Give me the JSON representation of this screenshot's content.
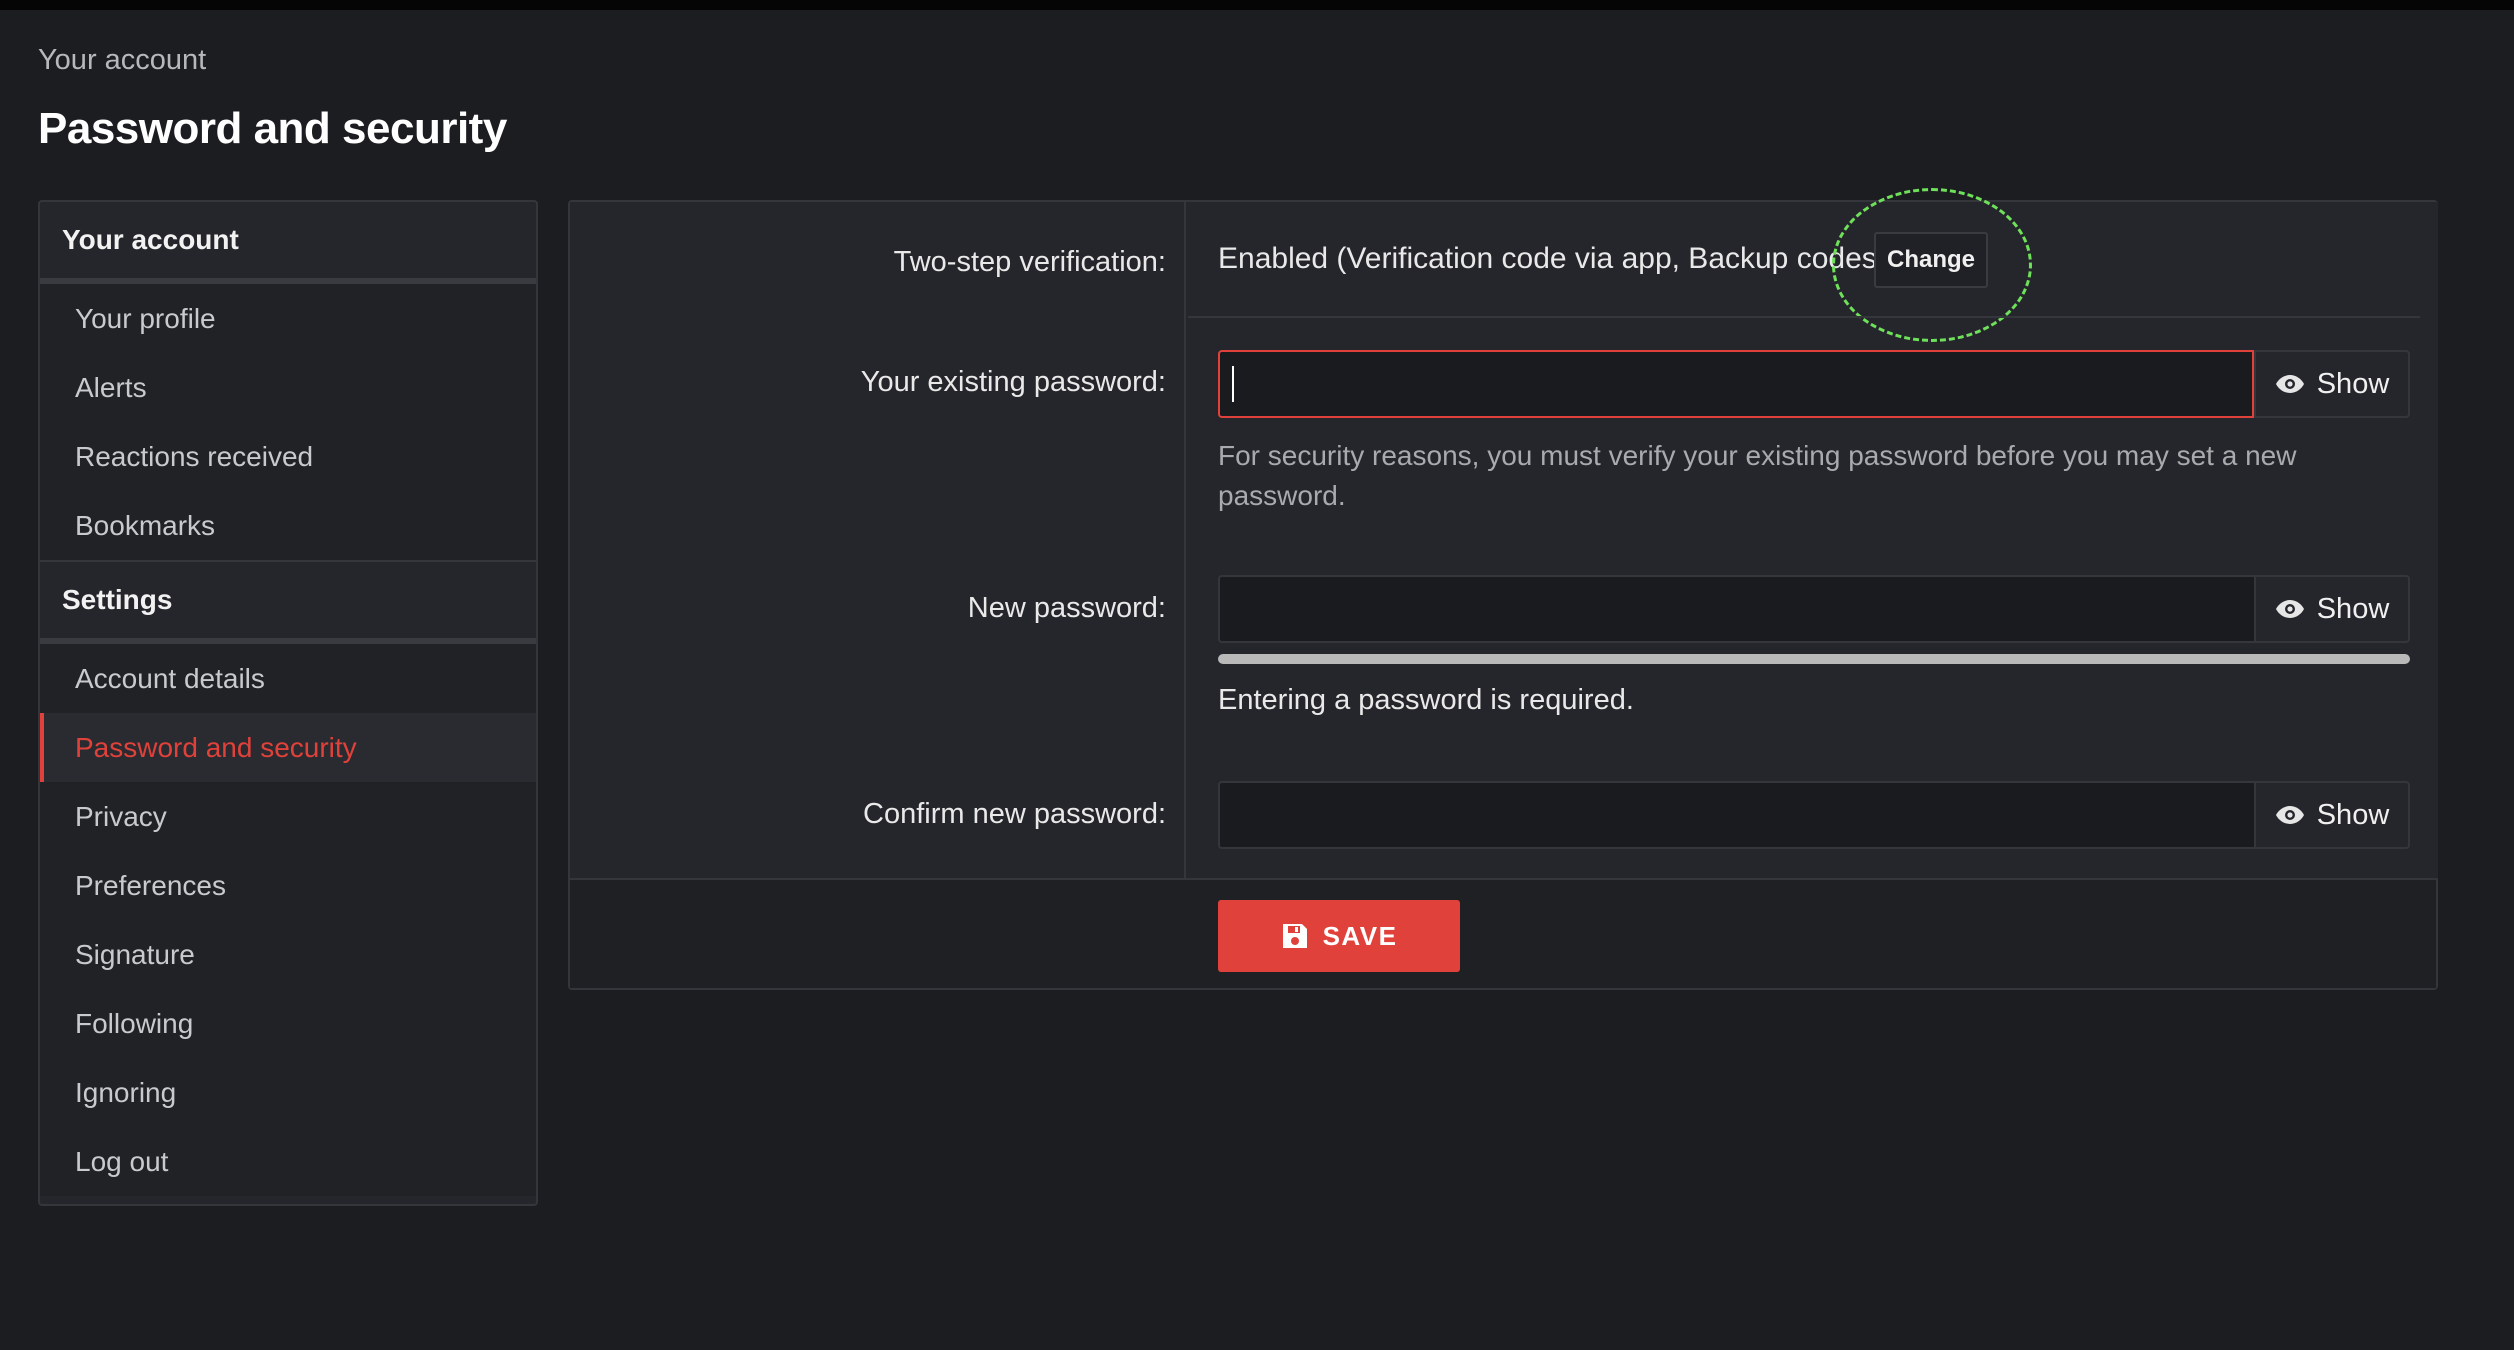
{
  "header": {
    "breadcrumb": "Your account",
    "title": "Password and security"
  },
  "sidebar": {
    "account_heading": "Your account",
    "account_items": [
      {
        "label": "Your profile"
      },
      {
        "label": "Alerts"
      },
      {
        "label": "Reactions received"
      },
      {
        "label": "Bookmarks"
      }
    ],
    "settings_heading": "Settings",
    "settings_items": [
      {
        "label": "Account details"
      },
      {
        "label": "Password and security",
        "active": true
      },
      {
        "label": "Privacy"
      },
      {
        "label": "Preferences"
      },
      {
        "label": "Signature"
      },
      {
        "label": "Following"
      },
      {
        "label": "Ignoring"
      },
      {
        "label": "Log out"
      }
    ]
  },
  "form": {
    "two_step": {
      "label": "Two-step verification:",
      "value": "Enabled (Verification code via app, Backup codes)",
      "change_label": "Change"
    },
    "existing_password": {
      "label": "Your existing password:",
      "value": "",
      "show_label": "Show",
      "hint": "For security reasons, you must verify your existing password before you may set a new password."
    },
    "new_password": {
      "label": "New password:",
      "value": "",
      "show_label": "Show",
      "strength": 0,
      "required_text": "Entering a password is required."
    },
    "confirm_password": {
      "label": "Confirm new password:",
      "value": "",
      "show_label": "Show"
    },
    "save_label": "SAVE"
  },
  "colors": {
    "accent": "#e0413a",
    "background": "#1c1d21",
    "panel": "#25262b",
    "highlight": "#6fe05a"
  },
  "icons": {
    "show": "eye-icon",
    "save": "floppy-disk-icon"
  }
}
